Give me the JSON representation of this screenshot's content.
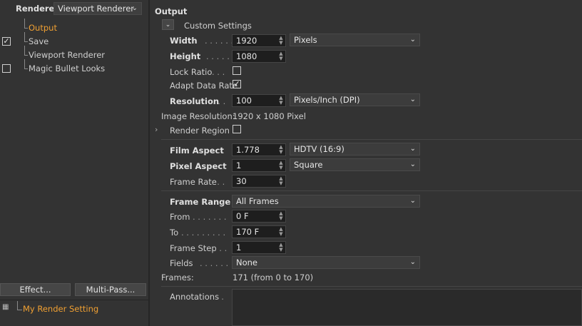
{
  "left": {
    "renderer_label": "Renderer",
    "renderer_value": "Viewport Renderer",
    "tree": [
      {
        "label": "Output",
        "checked": null,
        "active": true
      },
      {
        "label": "Save",
        "checked": true,
        "active": false
      },
      {
        "label": "Viewport Renderer",
        "checked": null,
        "active": false
      },
      {
        "label": "Magic Bullet Looks",
        "checked": false,
        "active": false
      }
    ],
    "effect_button": "Effect...",
    "multipass_button": "Multi-Pass...",
    "render_setting": "My Render Setting"
  },
  "output": {
    "title": "Output",
    "preset_label": "Custom Settings",
    "width_label": "Width",
    "width_dots": ". . . . . .",
    "width_value": "1920",
    "width_unit": "Pixels",
    "height_label": "Height",
    "height_dots": ". . . . . .",
    "height_value": "1080",
    "lock_ratio_label": "Lock Ratio",
    "lock_ratio_dots": ". . .",
    "lock_ratio_checked": false,
    "adapt_label": "Adapt Data Rate",
    "adapt_checked": true,
    "resolution_label": "Resolution",
    "resolution_dots": ". . .",
    "resolution_value": "100",
    "resolution_unit": "Pixels/Inch (DPI)",
    "image_res_label": "Image Resolution:",
    "image_res_value": "1920 x 1080 Pixel",
    "render_region_label": "Render Region",
    "render_region_checked": false,
    "film_aspect_label": "Film Aspect",
    "film_aspect_dots": ". .",
    "film_aspect_value": "1.778",
    "film_aspect_preset": "HDTV (16:9)",
    "pixel_aspect_label": "Pixel Aspect",
    "pixel_aspect_dots": ". .",
    "pixel_aspect_value": "1",
    "pixel_aspect_preset": "Square",
    "frame_rate_label": "Frame Rate",
    "frame_rate_dots": ". . .",
    "frame_rate_value": "30",
    "frame_range_label": "Frame Range",
    "frame_range_dots": ". .",
    "frame_range_value": "All Frames",
    "from_label": "From",
    "from_dots": ". . . . . . .",
    "from_value": "0 F",
    "to_label": "To",
    "to_dots": ". . . . . . . . .",
    "to_value": "170 F",
    "frame_step_label": "Frame Step",
    "frame_step_dots": ". . .",
    "frame_step_value": "1",
    "fields_label": "Fields",
    "fields_dots": ". . . . . .",
    "fields_value": "None",
    "frames_label": "Frames:",
    "frames_value": "171 (from 0 to 170)",
    "annotations_label": "Annotations",
    "annotations_dots": ". ."
  }
}
